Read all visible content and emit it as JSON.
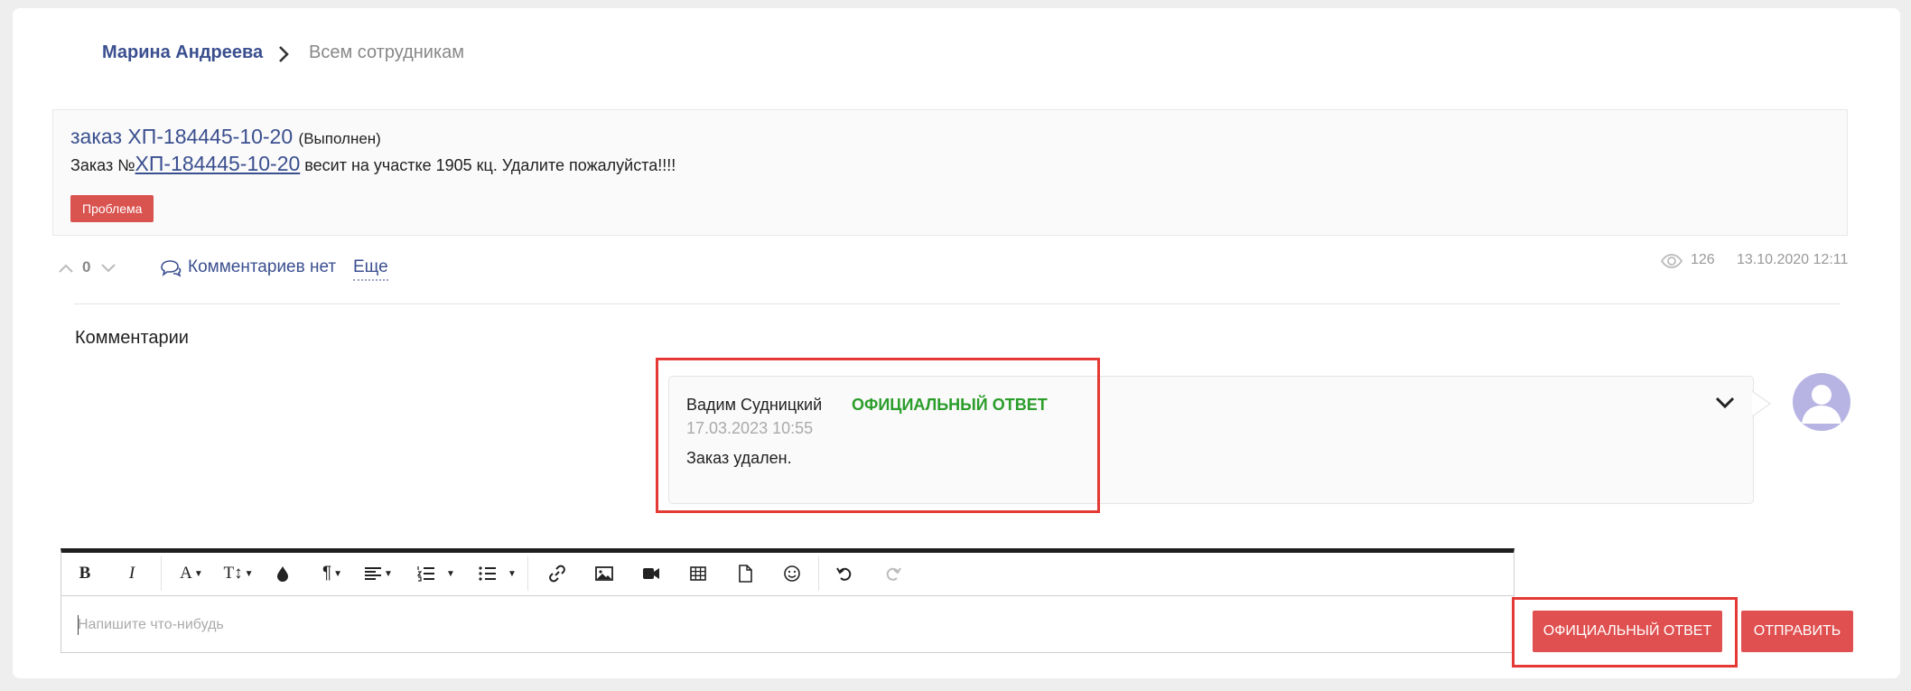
{
  "breadcrumb": {
    "author": "Марина Андреева",
    "audience": "Всем сотрудникам"
  },
  "post": {
    "title_prefix": "заказ ",
    "order_number": "ХП-184445-10-20",
    "status": "(Выполнен)",
    "body_prefix": "Заказ №",
    "body_link": "ХП-184445-10-20",
    "body_suffix": " весит на участке 1905 кц. Удалите пожалуйста!!!!",
    "tag": "Проблема",
    "votes": "0",
    "comments_label": "Комментариев нет",
    "more_label": "Еще",
    "views": "126",
    "date": "13.10.2020 12:11"
  },
  "comments_section": {
    "heading": "Комментарии",
    "items": [
      {
        "author": "Вадим Судницкий",
        "badge": "ОФИЦИАЛЬНЫЙ ОТВЕТ",
        "date": "17.03.2023 10:55",
        "text": "Заказ удален."
      }
    ]
  },
  "editor": {
    "placeholder": "Напишите что-нибудь",
    "toolbar": {
      "bold": "B",
      "italic": "I",
      "font_family": "A",
      "font_size": "T↕",
      "paragraph": "¶"
    }
  },
  "actions": {
    "official_label": "ОФИЦИАЛЬНЫЙ ОТВЕТ",
    "send_label": "ОТПРАВИТЬ"
  },
  "colors": {
    "link": "#3a4f8f",
    "danger": "#d9534f",
    "button": "#e05050",
    "official": "#2a9d2a",
    "highlight": "#e53935",
    "avatar_bg": "#b7b4e3"
  }
}
